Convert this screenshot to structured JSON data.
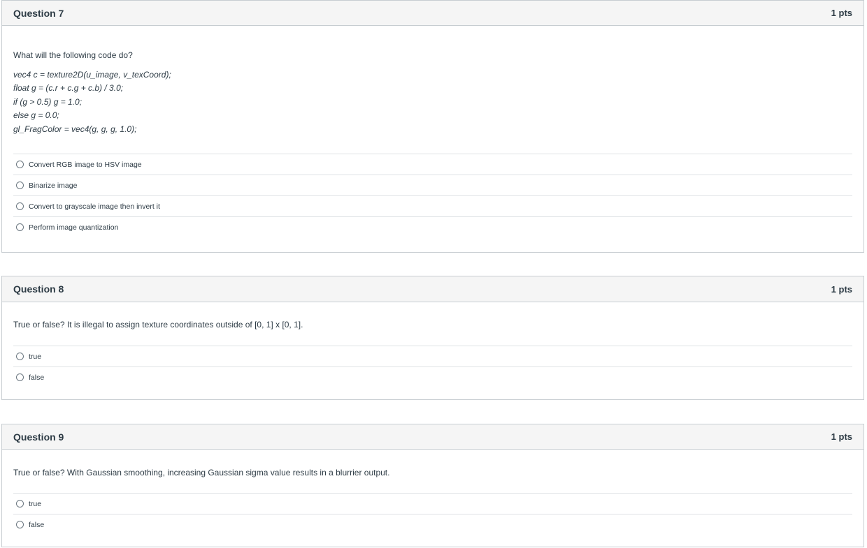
{
  "questions": [
    {
      "title": "Question 7",
      "points": "1 pts",
      "prompt": "What will the following code do?",
      "code": [
        "vec4 c = texture2D(u_image, v_texCoord);",
        "float g = (c.r + c.g + c.b) / 3.0;",
        "if (g > 0.5) g = 1.0;",
        "else g = 0.0;",
        "gl_FragColor = vec4(g, g, g, 1.0);"
      ],
      "answers": [
        "Convert RGB image to HSV image",
        "Binarize image",
        "Convert to grayscale image then invert it",
        "Perform image quantization"
      ]
    },
    {
      "title": "Question 8",
      "points": "1 pts",
      "prompt": "True or false? It is illegal to assign texture coordinates outside of [0, 1] x [0, 1].",
      "answers": [
        "true",
        "false"
      ]
    },
    {
      "title": "Question 9",
      "points": "1 pts",
      "prompt": "True or false? With Gaussian smoothing, increasing Gaussian sigma value results in a blurrier output.",
      "answers": [
        "true",
        "false"
      ]
    }
  ]
}
